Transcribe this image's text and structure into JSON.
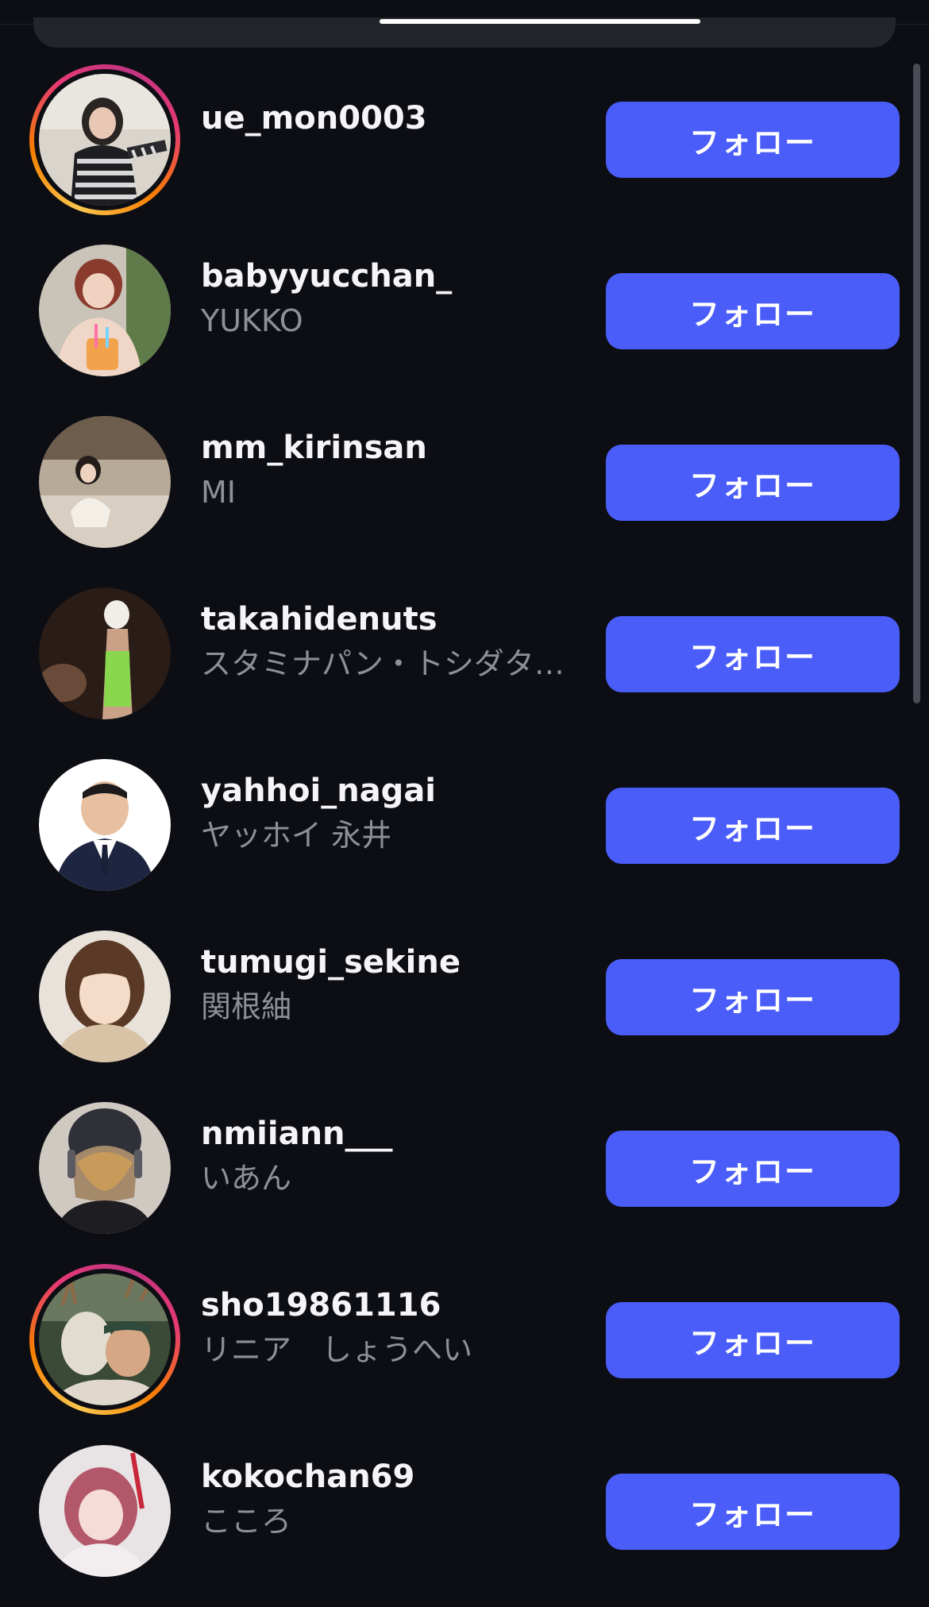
{
  "follow_label": "フォロー",
  "colors": {
    "background": "#0c0e14",
    "button": "#4a5df9",
    "username": "#f5f5f7",
    "fullname": "#8e9099"
  },
  "users": [
    {
      "username": "ue_mon0003",
      "fullname": "",
      "story_ring": true
    },
    {
      "username": "babyyucchan_",
      "fullname": "YUKKO",
      "story_ring": false
    },
    {
      "username": "mm_kirinsan",
      "fullname": "MI",
      "story_ring": false
    },
    {
      "username": "takahidenuts",
      "fullname": "スタミナパン・トシダタ…",
      "story_ring": false
    },
    {
      "username": "yahhoi_nagai",
      "fullname": "ヤッホイ 永井",
      "story_ring": false
    },
    {
      "username": "tumugi_sekine",
      "fullname": "関根紬",
      "story_ring": false
    },
    {
      "username": "nmiiann___",
      "fullname": "いあん",
      "story_ring": false
    },
    {
      "username": "sho19861116",
      "fullname": "リニア　しょうへい",
      "story_ring": true
    },
    {
      "username": "kokochan69",
      "fullname": "こころ",
      "story_ring": false
    }
  ]
}
